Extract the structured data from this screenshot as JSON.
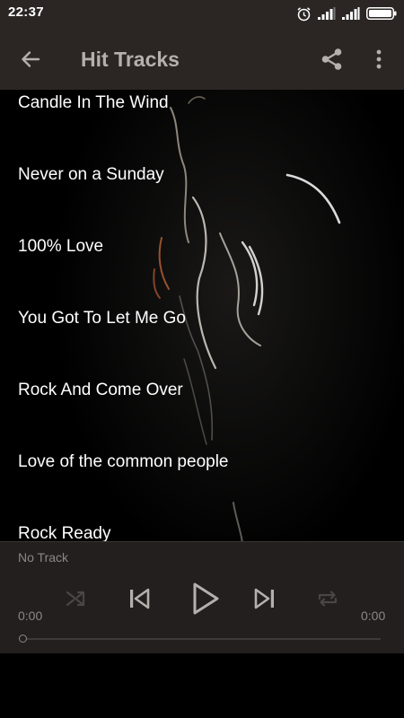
{
  "status_bar": {
    "time": "22:37",
    "icons": [
      "alarm-icon",
      "signal-icon",
      "signal-icon",
      "battery-icon"
    ]
  },
  "app_bar": {
    "back_icon": "arrow-left-icon",
    "title": "Hit Tracks",
    "share_icon": "share-icon",
    "more_icon": "more-vertical-icon"
  },
  "tracks": [
    {
      "title": "Candle In The Wind"
    },
    {
      "title": "Never on a Sunday"
    },
    {
      "title": "100% Love"
    },
    {
      "title": "You Got To Let Me Go"
    },
    {
      "title": "Rock And Come Over"
    },
    {
      "title": "Love of the common people"
    },
    {
      "title": "Rock Ready"
    }
  ],
  "player": {
    "now_playing": "No Track",
    "elapsed": "0:00",
    "total": "0:00",
    "progress": 0,
    "controls": [
      "shuffle-icon",
      "previous-icon",
      "play-icon",
      "next-icon",
      "repeat-icon"
    ]
  },
  "colors": {
    "bar_background": "#2b2624",
    "player_background": "#221f1e",
    "muted_text": "#8d8784",
    "title_text": "#b5b0ad",
    "track_text": "#ffffff"
  }
}
